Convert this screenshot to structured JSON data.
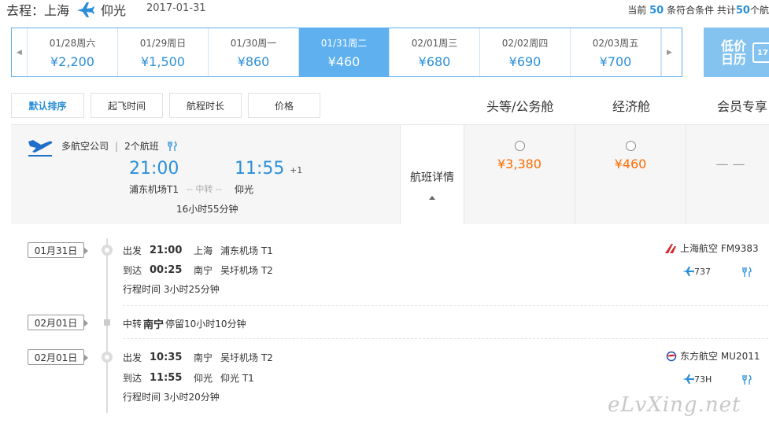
{
  "header": {
    "route_label": "去程：上海",
    "destination": "仰光",
    "date": "2017-01-31",
    "count_prefix": "当前",
    "count_current": "50",
    "count_mid": "条符合条件 共计",
    "count_total": "50",
    "count_suffix": "个航"
  },
  "dates": [
    {
      "date": "01/28周六",
      "price": "¥2,200",
      "active": false
    },
    {
      "date": "01/29周日",
      "price": "¥1,500",
      "active": false
    },
    {
      "date": "01/30周一",
      "price": "¥860",
      "active": false
    },
    {
      "date": "01/31周二",
      "price": "¥460",
      "active": true
    },
    {
      "date": "02/01周三",
      "price": "¥680",
      "active": false
    },
    {
      "date": "02/02周四",
      "price": "¥690",
      "active": false
    },
    {
      "date": "02/03周五",
      "price": "¥700",
      "active": false
    }
  ],
  "calendar": {
    "label_top": "低价",
    "label_bottom": "日历",
    "day": "17"
  },
  "sort": {
    "default": "默认排序",
    "departure": "起飞时间",
    "duration": "航程时长",
    "price": "价格"
  },
  "cabins": {
    "first": "头等/公务舱",
    "economy": "经济舱",
    "member": "会员专享"
  },
  "flight": {
    "airline": "多航空公司",
    "flight_count": "2个航班",
    "dep_time": "21:00",
    "arr_time": "11:55",
    "plus_day": "+1",
    "dep_airport": "浦东机场T1",
    "via": "-- 中转 --",
    "arr_airport": "仰光",
    "duration": "16小时55分钟",
    "detail_label": "航班详情",
    "fare_first": "¥3,380",
    "fare_economy": "¥460",
    "fare_member": "— —"
  },
  "segments": [
    {
      "date": "01月31日",
      "dep_label": "出发",
      "dep_time": "21:00",
      "dep_city": "上海",
      "dep_airport": "浦东机场 T1",
      "arr_label": "到达",
      "arr_time": "00:25",
      "arr_city": "南宁",
      "arr_airport": "吴圩机场 T2",
      "trip_time": "行程时间 3小时25分钟",
      "carrier": "上海航空 FM9383",
      "aircraft": "737"
    },
    {
      "date": "02月01日",
      "dep_label": "出发",
      "dep_time": "10:35",
      "dep_city": "南宁",
      "dep_airport": "吴圩机场 T2",
      "arr_label": "到达",
      "arr_time": "11:55",
      "arr_city": "仰光",
      "arr_airport": "仰光 T1",
      "trip_time": "行程时间 3小时20分钟",
      "carrier": "东方航空 MU2011",
      "aircraft": "73H"
    }
  ],
  "transfer": {
    "date": "02月01日",
    "prefix": "中转",
    "city": "南宁",
    "stay": "停留10小时10分钟"
  },
  "watermark": "eLvXing.net",
  "colors": {
    "accent": "#2b8fd8",
    "fare": "#ff6a00",
    "active_date": "#5fb0ef"
  }
}
